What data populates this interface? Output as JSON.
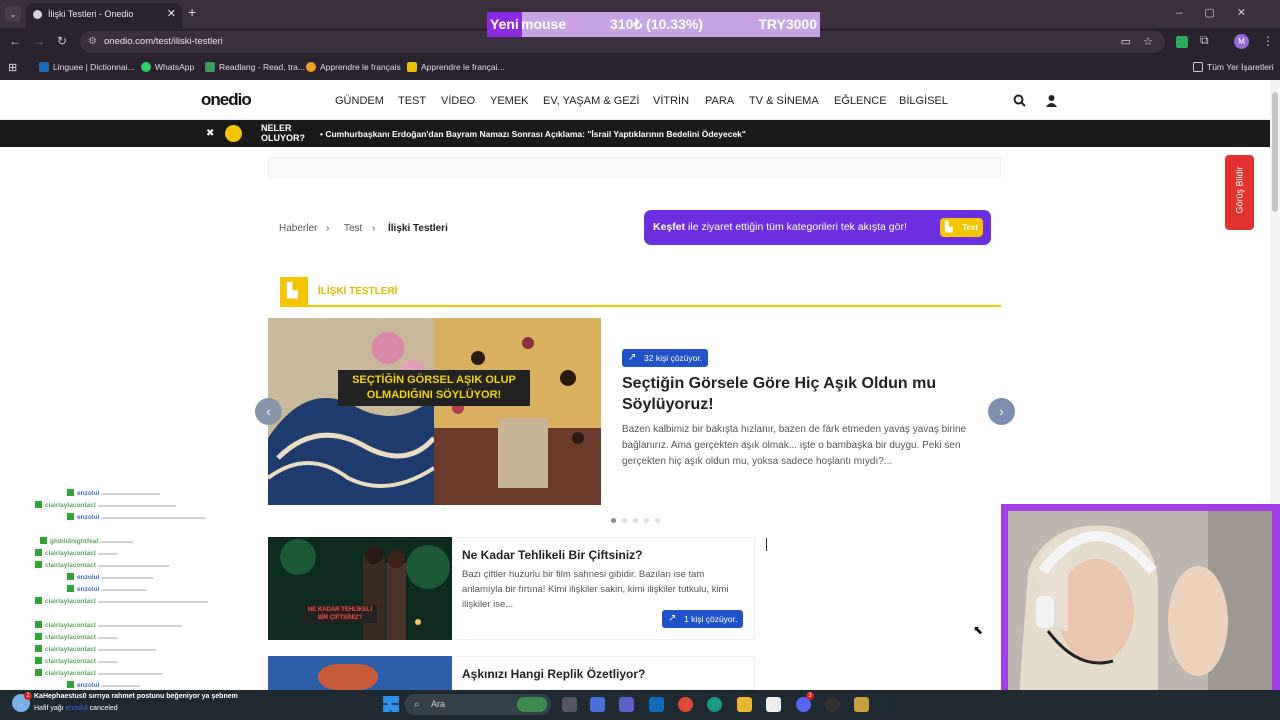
{
  "browser": {
    "tab_title": "İlişki Testleri - Onedio",
    "url": "onedio.com/test/iliski-testleri",
    "bookmarks": [
      "Linguee | Dictionnai...",
      "WhatsApp",
      "Readlang - Read, tra...",
      "Apprendre le français",
      "Apprendre le françai..."
    ],
    "all_bookmarks": "Tüm Yer İşaretleri",
    "profile_initial": "M"
  },
  "ticker": {
    "new": "Yeni",
    "item": "mouse",
    "change": "310₺ (10.33%)",
    "total": "TRY3000"
  },
  "site": {
    "logo": "onedio",
    "nav": [
      "GÜNDEM",
      "TEST",
      "VİDEO",
      "YEMEK",
      "EV, YAŞAM & GEZİ",
      "VİTRİN",
      "PARA",
      "TV & SİNEMA",
      "EĞLENCE",
      "BİLGİSEL"
    ],
    "neler_line1": "NELER",
    "neler_line2": "OLUYOR?",
    "headline": "Cumhurbaşkanı Erdoğan'dan Bayram Namazı Sonrası Açıklama: \"İsrail Yaptıklarının Bedelini Ödeyecek\"",
    "breadcrumb": [
      "Haberler",
      "Test",
      "İlişki Testleri"
    ],
    "kesfet_bold": "Keşfet",
    "kesfet_text": " ile ziyaret ettiğin tüm kategorileri tek akışta gör!",
    "kesfet_button": "Test",
    "section_title": "İLİŞKİ TESTLERİ",
    "feedback": "Görüş Bildir"
  },
  "hero": {
    "image_text": "SEÇTİĞİN GÖRSEL AŞIK OLUP OLMADIĞINI SÖYLÜYOR!",
    "badge": "32 kişi çözüyor.",
    "title": "Seçtiğin Görsele Göre Hiç Aşık Oldun mu Söylüyoruz!",
    "description": "Bazen kalbimiz bir bakışta hızlanır, bazen de fark etmeden yavaş yavaş birine bağlanırız. Ama gerçekten aşık olmak... işte o bambaşka bir duygu. Peki sen gerçekten hiç aşık oldun mu, yoksa sadece hoşlantı mıydı?...",
    "slide_count": 5,
    "active_slide": 1
  },
  "cards": [
    {
      "title": "Ne Kadar Tehlikeli Bir Çiftsiniz?",
      "image_text": "NE KADAR TEHLİKELİ BİR ÇİFTSİNİZ?",
      "description": "Bazı çiftler huzurlu bir film sahnesi gibidir. Bazıları ise tam anlamıyla bir fırtına! Kimi ilişkiler sakin, kimi ilişkiler tutkulu, kimi ilişkiler ise...",
      "badge": "1 kişi çözüyor."
    },
    {
      "title": "Aşkınızı Hangi Replik Özetliyor?"
    }
  ],
  "chat": [
    {
      "user": "enzolul",
      "color": "blue"
    },
    {
      "user": "clairlaylacontact",
      "color": "green"
    },
    {
      "user": "enzolul",
      "color": "blue"
    },
    {
      "user": "ghibliilnightfeat",
      "color": "green"
    },
    {
      "user": "clairlaylacontact",
      "color": "green"
    },
    {
      "user": "clairlaylacontact",
      "color": "green"
    },
    {
      "user": "enzolul",
      "color": "blue"
    },
    {
      "user": "enzolul",
      "color": "blue"
    },
    {
      "user": "clairlaylacontact",
      "color": "green"
    },
    {
      "user": "clairlaylacontact",
      "color": "green"
    },
    {
      "user": "clairlaylacontact",
      "color": "green"
    },
    {
      "user": "clairlaylacontact",
      "color": "green"
    },
    {
      "user": "clairlaylacontact",
      "color": "green"
    },
    {
      "user": "clairlaylacontact",
      "color": "green"
    },
    {
      "user": "enzolul",
      "color": "blue"
    }
  ],
  "taskbar": {
    "notif_line1": "KaHephaestus0 sırrıya rahmet postunu beğeniyor ya şebnem",
    "notif_line2": "Hafif yağı",
    "notif_line2b": "canceled",
    "search_placeholder": "Ara",
    "discord_badge": "3",
    "notif_badge": "2"
  }
}
